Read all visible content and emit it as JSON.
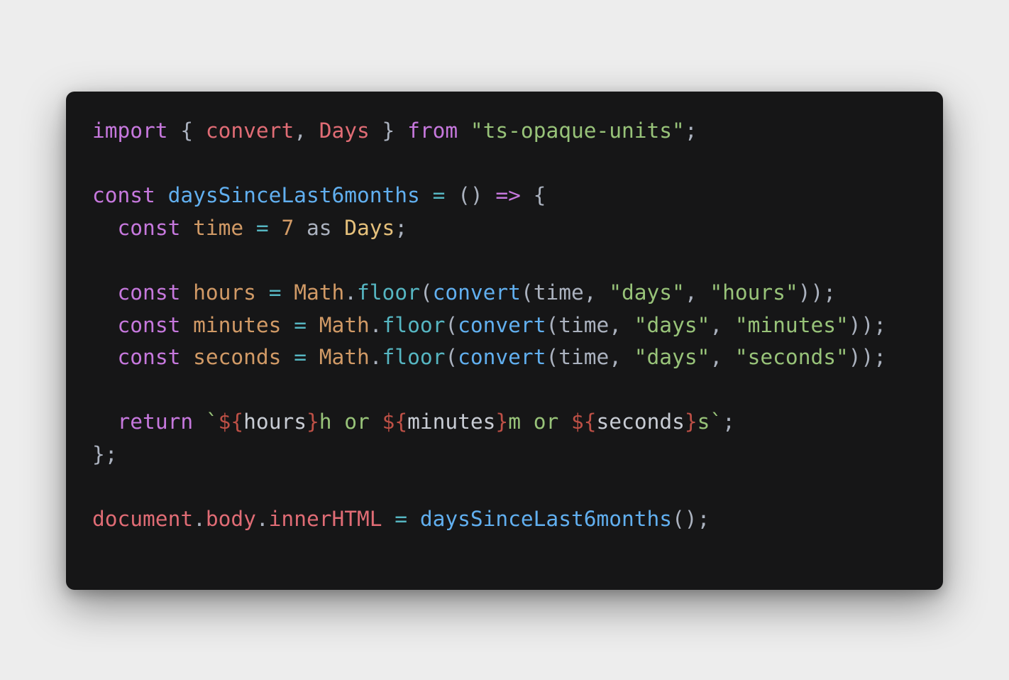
{
  "editor": {
    "theme_colors": {
      "background": "#161617",
      "page_background": "#ededed",
      "keyword": "#c678dd",
      "import_name": "#e06c75",
      "function_name": "#61afef",
      "variable": "#d19a66",
      "string": "#98c379",
      "method": "#56b6c2",
      "type": "#e5c07b",
      "punctuation": "#abb2bf",
      "template_brace": "#be5046",
      "template_text": "#98c379",
      "interpolated": "#c8ccd4"
    },
    "lines": [
      {
        "tokens": [
          {
            "text": "import",
            "kind": "keyword"
          },
          {
            "text": " { ",
            "kind": "punctuation"
          },
          {
            "text": "convert",
            "kind": "import_name"
          },
          {
            "text": ", ",
            "kind": "punctuation"
          },
          {
            "text": "Days",
            "kind": "import_name"
          },
          {
            "text": " } ",
            "kind": "punctuation"
          },
          {
            "text": "from",
            "kind": "keyword"
          },
          {
            "text": " ",
            "kind": "punctuation"
          },
          {
            "text": "\"ts-opaque-units\"",
            "kind": "string"
          },
          {
            "text": ";",
            "kind": "punctuation"
          }
        ]
      },
      {
        "tokens": []
      },
      {
        "tokens": [
          {
            "text": "const",
            "kind": "keyword"
          },
          {
            "text": " ",
            "kind": "punctuation"
          },
          {
            "text": "daysSinceLast6months",
            "kind": "function_name"
          },
          {
            "text": " ",
            "kind": "punctuation"
          },
          {
            "text": "=",
            "kind": "method"
          },
          {
            "text": " () ",
            "kind": "punctuation"
          },
          {
            "text": "=>",
            "kind": "keyword"
          },
          {
            "text": " {",
            "kind": "punctuation"
          }
        ]
      },
      {
        "tokens": [
          {
            "text": "  ",
            "kind": "punctuation"
          },
          {
            "text": "const",
            "kind": "keyword"
          },
          {
            "text": " ",
            "kind": "punctuation"
          },
          {
            "text": "time",
            "kind": "variable"
          },
          {
            "text": " ",
            "kind": "punctuation"
          },
          {
            "text": "=",
            "kind": "method"
          },
          {
            "text": " ",
            "kind": "punctuation"
          },
          {
            "text": "7",
            "kind": "variable"
          },
          {
            "text": " as ",
            "kind": "punctuation"
          },
          {
            "text": "Days",
            "kind": "type"
          },
          {
            "text": ";",
            "kind": "punctuation"
          }
        ]
      },
      {
        "tokens": []
      },
      {
        "tokens": [
          {
            "text": "  ",
            "kind": "punctuation"
          },
          {
            "text": "const",
            "kind": "keyword"
          },
          {
            "text": " ",
            "kind": "punctuation"
          },
          {
            "text": "hours",
            "kind": "variable"
          },
          {
            "text": " ",
            "kind": "punctuation"
          },
          {
            "text": "=",
            "kind": "method"
          },
          {
            "text": " ",
            "kind": "punctuation"
          },
          {
            "text": "Math",
            "kind": "variable"
          },
          {
            "text": ".",
            "kind": "punctuation"
          },
          {
            "text": "floor",
            "kind": "method"
          },
          {
            "text": "(",
            "kind": "punctuation"
          },
          {
            "text": "convert",
            "kind": "function_name"
          },
          {
            "text": "(time, ",
            "kind": "punctuation"
          },
          {
            "text": "\"days\"",
            "kind": "string"
          },
          {
            "text": ", ",
            "kind": "punctuation"
          },
          {
            "text": "\"hours\"",
            "kind": "string"
          },
          {
            "text": "));",
            "kind": "punctuation"
          }
        ]
      },
      {
        "tokens": [
          {
            "text": "  ",
            "kind": "punctuation"
          },
          {
            "text": "const",
            "kind": "keyword"
          },
          {
            "text": " ",
            "kind": "punctuation"
          },
          {
            "text": "minutes",
            "kind": "variable"
          },
          {
            "text": " ",
            "kind": "punctuation"
          },
          {
            "text": "=",
            "kind": "method"
          },
          {
            "text": " ",
            "kind": "punctuation"
          },
          {
            "text": "Math",
            "kind": "variable"
          },
          {
            "text": ".",
            "kind": "punctuation"
          },
          {
            "text": "floor",
            "kind": "method"
          },
          {
            "text": "(",
            "kind": "punctuation"
          },
          {
            "text": "convert",
            "kind": "function_name"
          },
          {
            "text": "(time, ",
            "kind": "punctuation"
          },
          {
            "text": "\"days\"",
            "kind": "string"
          },
          {
            "text": ", ",
            "kind": "punctuation"
          },
          {
            "text": "\"minutes\"",
            "kind": "string"
          },
          {
            "text": "));",
            "kind": "punctuation"
          }
        ]
      },
      {
        "tokens": [
          {
            "text": "  ",
            "kind": "punctuation"
          },
          {
            "text": "const",
            "kind": "keyword"
          },
          {
            "text": " ",
            "kind": "punctuation"
          },
          {
            "text": "seconds",
            "kind": "variable"
          },
          {
            "text": " ",
            "kind": "punctuation"
          },
          {
            "text": "=",
            "kind": "method"
          },
          {
            "text": " ",
            "kind": "punctuation"
          },
          {
            "text": "Math",
            "kind": "variable"
          },
          {
            "text": ".",
            "kind": "punctuation"
          },
          {
            "text": "floor",
            "kind": "method"
          },
          {
            "text": "(",
            "kind": "punctuation"
          },
          {
            "text": "convert",
            "kind": "function_name"
          },
          {
            "text": "(time, ",
            "kind": "punctuation"
          },
          {
            "text": "\"days\"",
            "kind": "string"
          },
          {
            "text": ", ",
            "kind": "punctuation"
          },
          {
            "text": "\"seconds\"",
            "kind": "string"
          },
          {
            "text": "));",
            "kind": "punctuation"
          }
        ]
      },
      {
        "tokens": []
      },
      {
        "tokens": [
          {
            "text": "  ",
            "kind": "punctuation"
          },
          {
            "text": "return",
            "kind": "keyword"
          },
          {
            "text": " ",
            "kind": "punctuation"
          },
          {
            "text": "`",
            "kind": "template_text"
          },
          {
            "text": "${",
            "kind": "template_brace"
          },
          {
            "text": "hours",
            "kind": "interpolated"
          },
          {
            "text": "}",
            "kind": "template_brace"
          },
          {
            "text": "h or ",
            "kind": "template_text"
          },
          {
            "text": "${",
            "kind": "template_brace"
          },
          {
            "text": "minutes",
            "kind": "interpolated"
          },
          {
            "text": "}",
            "kind": "template_brace"
          },
          {
            "text": "m or ",
            "kind": "template_text"
          },
          {
            "text": "${",
            "kind": "template_brace"
          },
          {
            "text": "seconds",
            "kind": "interpolated"
          },
          {
            "text": "}",
            "kind": "template_brace"
          },
          {
            "text": "s`",
            "kind": "template_text"
          },
          {
            "text": ";",
            "kind": "punctuation"
          }
        ]
      },
      {
        "tokens": [
          {
            "text": "};",
            "kind": "punctuation"
          }
        ]
      },
      {
        "tokens": []
      },
      {
        "tokens": [
          {
            "text": "document",
            "kind": "import_name"
          },
          {
            "text": ".",
            "kind": "punctuation"
          },
          {
            "text": "body",
            "kind": "import_name"
          },
          {
            "text": ".",
            "kind": "punctuation"
          },
          {
            "text": "innerHTML",
            "kind": "import_name"
          },
          {
            "text": " ",
            "kind": "punctuation"
          },
          {
            "text": "=",
            "kind": "method"
          },
          {
            "text": " ",
            "kind": "punctuation"
          },
          {
            "text": "daysSinceLast6months",
            "kind": "function_name"
          },
          {
            "text": "();",
            "kind": "punctuation"
          }
        ]
      }
    ]
  }
}
